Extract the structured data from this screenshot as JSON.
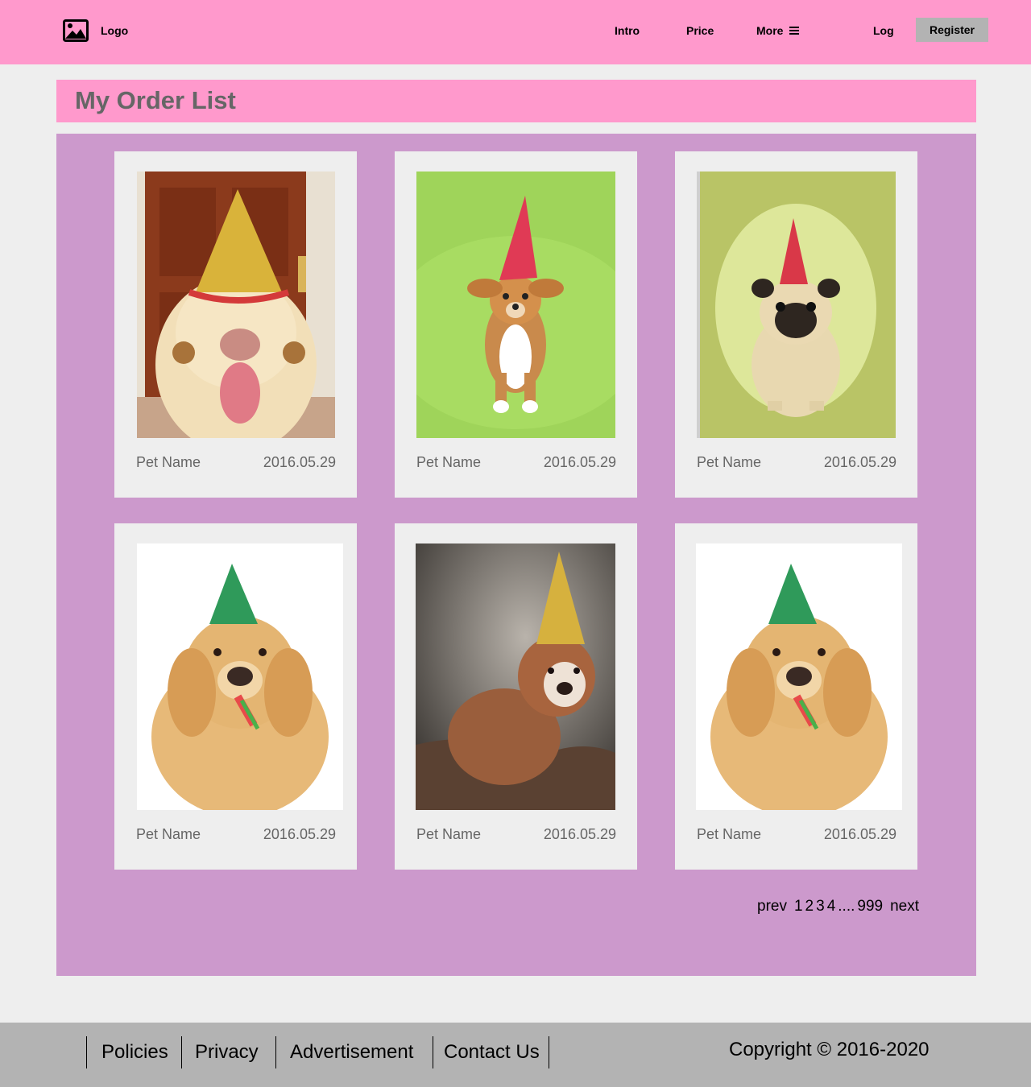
{
  "header": {
    "logo_label": "Logo",
    "logo_icon": "image-icon",
    "nav": {
      "intro": "Intro",
      "price": "Price",
      "more": "More",
      "more_icon": "menu-icon"
    },
    "log": "Log",
    "register": "Register"
  },
  "page": {
    "title": "My Order List"
  },
  "orders": [
    {
      "name": "Pet Name",
      "date": "2016.05.29",
      "photo": "yellow labrador in gold party hat in front of wooden door"
    },
    {
      "name": "Pet Name",
      "date": "2016.05.29",
      "photo": "small tan dog in red party hat on green background"
    },
    {
      "name": "Pet Name",
      "date": "2016.05.29",
      "photo": "pug in red party hat on green background"
    },
    {
      "name": "Pet Name",
      "date": "2016.05.29",
      "photo": "golden retriever in green party hat with party blower"
    },
    {
      "name": "Pet Name",
      "date": "2016.05.29",
      "photo": "bulldog puppy in gold party hat on brown blanket"
    },
    {
      "name": "Pet Name",
      "date": "2016.05.29",
      "photo": "golden retriever in green party hat with party blower"
    }
  ],
  "pagination": {
    "prev": "prev",
    "pages": [
      "1",
      "2",
      "3",
      "4"
    ],
    "ellipsis": "....",
    "last": "999",
    "next": "next"
  },
  "footer": {
    "links": [
      "Policies",
      "Privacy",
      "Advertisement",
      "Contact Us"
    ],
    "copyright": "Copyright  © 2016-2020"
  },
  "colors": {
    "header_bg": "#ff99cc",
    "panel_bg": "#cc99cc",
    "card_bg": "#eeeeee",
    "footer_bg": "#b3b3b3",
    "register_bg": "#b3b3b3"
  }
}
